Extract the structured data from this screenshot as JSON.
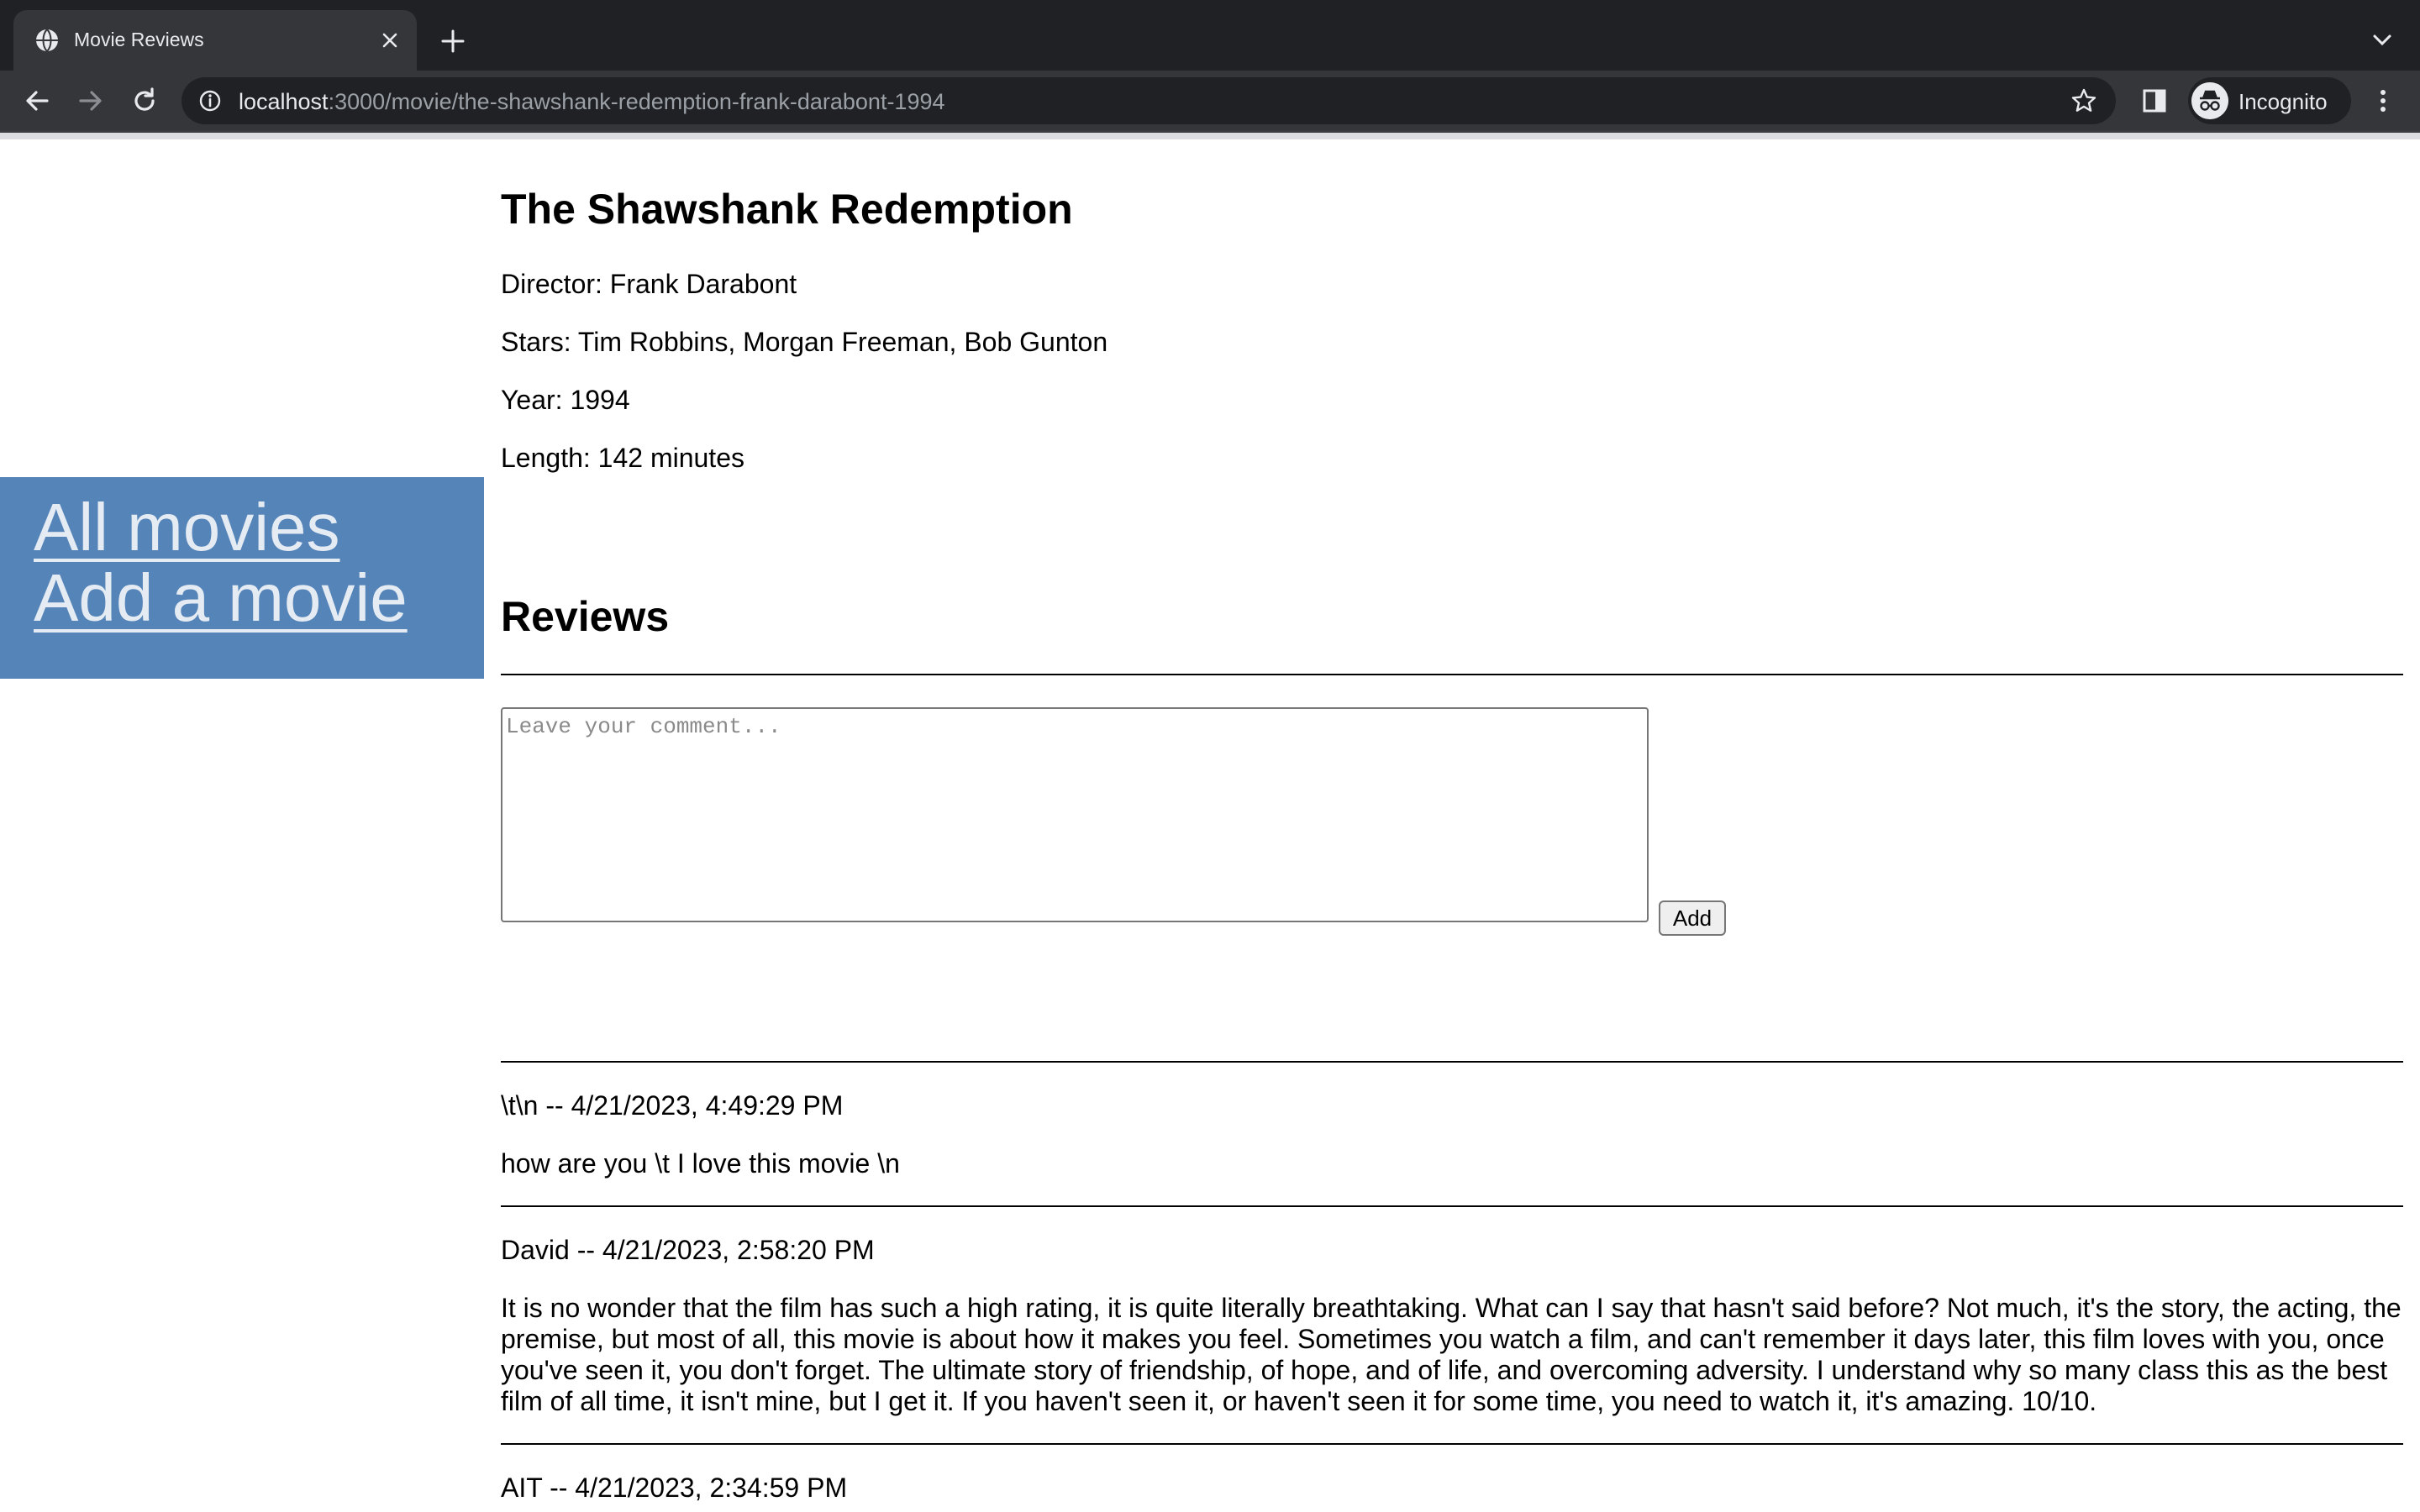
{
  "browser": {
    "tab_title": "Movie Reviews",
    "url_host": "localhost",
    "url_path": ":3000/movie/the-shawshank-redemption-frank-darabont-1994",
    "profile_label": "Incognito",
    "icons": [
      "globe-icon",
      "close-icon",
      "plus-icon",
      "chevron-down-icon",
      "back-arrow-icon",
      "forward-arrow-icon",
      "reload-icon",
      "info-icon",
      "star-icon",
      "side-panel-icon",
      "incognito-icon",
      "kebab-menu-icon"
    ]
  },
  "nav": {
    "all_movies": "All movies",
    "add_movie": "Add a movie"
  },
  "movie": {
    "title": "The Shawshank Redemption",
    "director": "Director: Frank Darabont",
    "stars": "Stars: Tim Robbins, Morgan Freeman, Bob Gunton",
    "year": "Year: 1994",
    "length": "Length: 142 minutes"
  },
  "reviews": {
    "heading": "Reviews",
    "comment_placeholder": "Leave your comment...",
    "add_label": "Add",
    "items": [
      {
        "header": "\\t\\n -- 4/21/2023, 4:49:29 PM",
        "body": "how are you \\t I love this movie \\n"
      },
      {
        "header": "David -- 4/21/2023, 2:58:20 PM",
        "body": "It is no wonder that the film has such a high rating, it is quite literally breathtaking. What can I say that hasn't said before? Not much, it's the story, the acting, the premise, but most of all, this movie is about how it makes you feel. Sometimes you watch a film, and can't remember it days later, this film loves with you, once you've seen it, you don't forget. The ultimate story of friendship, of hope, and of life, and overcoming adversity. I understand why so many class this as the best film of all time, it isn't mine, but I get it. If you haven't seen it, or haven't seen it for some time, you need to watch it, it's amazing. 10/10."
      },
      {
        "header": "AIT -- 4/21/2023, 2:34:59 PM",
        "body": ""
      }
    ]
  },
  "colors": {
    "sidenav_bg": "#5584b9",
    "sidenav_link": "#e4ebf3",
    "chrome_dark": "#202124",
    "chrome_toolbar": "#35363a"
  }
}
